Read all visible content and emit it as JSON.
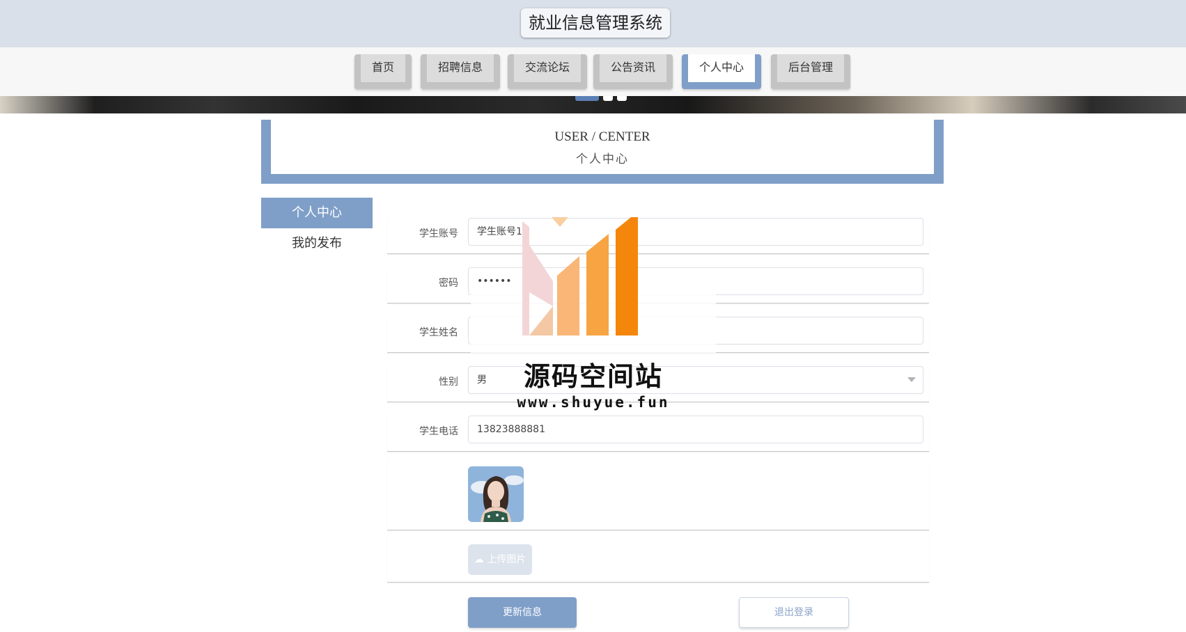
{
  "header": {
    "title": "就业信息管理系统"
  },
  "nav": {
    "tabs": [
      {
        "label": "首页"
      },
      {
        "label": "招聘信息"
      },
      {
        "label": "交流论坛"
      },
      {
        "label": "公告资讯"
      },
      {
        "label": "个人中心",
        "active": true
      },
      {
        "label": "后台管理"
      }
    ]
  },
  "section": {
    "title_en": "USER / CENTER",
    "title_cn": "个人中心"
  },
  "sidebar": {
    "items": [
      {
        "label": "个人中心",
        "active": true
      },
      {
        "label": "我的发布"
      }
    ]
  },
  "form": {
    "account": {
      "label": "学生账号",
      "value": "学生账号1"
    },
    "password": {
      "label": "密码",
      "value": "••••••"
    },
    "name": {
      "label": "学生姓名",
      "value": ""
    },
    "gender": {
      "label": "性别",
      "value": "男"
    },
    "phone": {
      "label": "学生电话",
      "value": "13823888881"
    },
    "upload_label": "上传图片",
    "update_label": "更新信息",
    "logout_label": "退出登录"
  },
  "watermark": {
    "text": "源码空间站",
    "url": "www.shuyue.fun"
  },
  "colors": {
    "accent": "#7f9fc8",
    "header_bg": "#d9e0ea",
    "tab_inactive": "#c3c3c3",
    "watermark_orange": "#f5860c"
  }
}
